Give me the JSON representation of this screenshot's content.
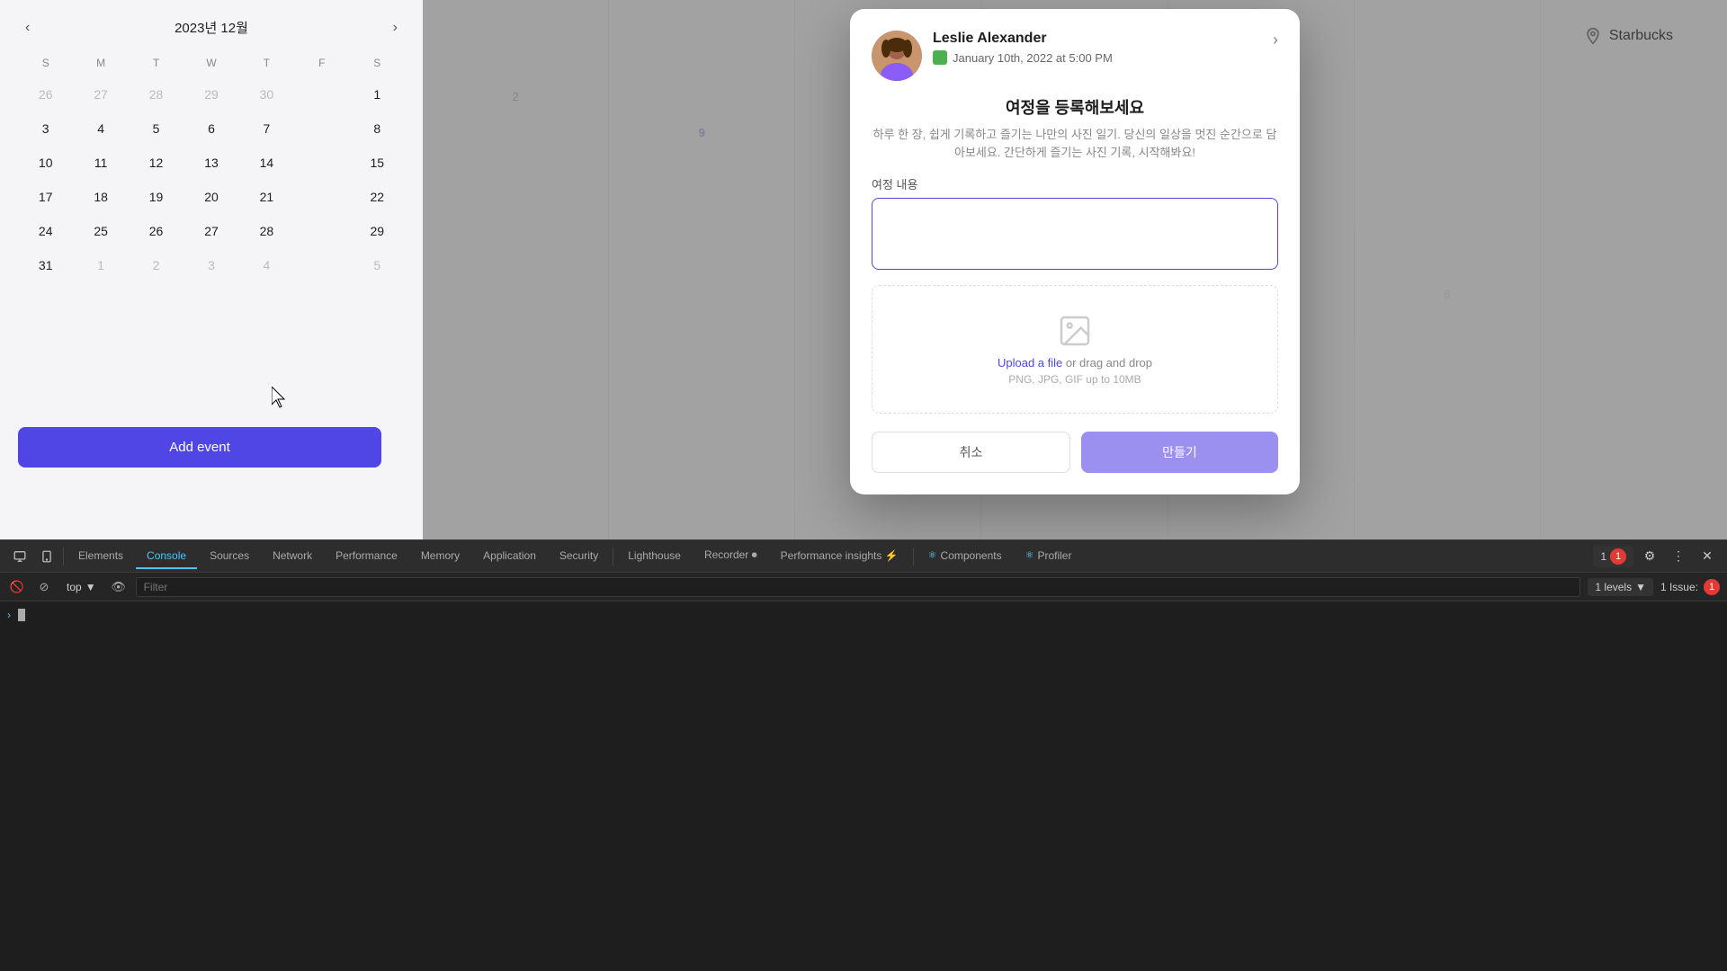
{
  "calendar": {
    "title": "2023년 12월",
    "weekdays": [
      "S",
      "M",
      "T",
      "W",
      "T",
      "F",
      "S"
    ],
    "weeks": [
      [
        {
          "day": "26",
          "type": "other-month"
        },
        {
          "day": "27",
          "type": "other-month"
        },
        {
          "day": "28",
          "type": "other-month"
        },
        {
          "day": "29",
          "type": "other-month"
        },
        {
          "day": "30",
          "type": "other-month"
        },
        {
          "day": "",
          "type": "empty"
        },
        {
          "day": "1",
          "type": "normal"
        }
      ],
      [
        {
          "day": "3",
          "type": "normal"
        },
        {
          "day": "4",
          "type": "normal"
        },
        {
          "day": "5",
          "type": "normal"
        },
        {
          "day": "6",
          "type": "normal"
        },
        {
          "day": "7",
          "type": "normal"
        },
        {
          "day": "",
          "type": "empty"
        },
        {
          "day": "8",
          "type": "normal"
        }
      ],
      [
        {
          "day": "10",
          "type": "normal"
        },
        {
          "day": "11",
          "type": "normal"
        },
        {
          "day": "12",
          "type": "normal"
        },
        {
          "day": "13",
          "type": "normal"
        },
        {
          "day": "14",
          "type": "normal"
        },
        {
          "day": "",
          "type": "empty"
        },
        {
          "day": "15",
          "type": "normal"
        }
      ],
      [
        {
          "day": "17",
          "type": "normal"
        },
        {
          "day": "18",
          "type": "normal"
        },
        {
          "day": "19",
          "type": "normal"
        },
        {
          "day": "20",
          "type": "normal"
        },
        {
          "day": "21",
          "type": "normal"
        },
        {
          "day": "",
          "type": "empty"
        },
        {
          "day": "22",
          "type": "normal"
        }
      ],
      [
        {
          "day": "24",
          "type": "normal"
        },
        {
          "day": "25",
          "type": "normal"
        },
        {
          "day": "26",
          "type": "normal"
        },
        {
          "day": "27",
          "type": "normal"
        },
        {
          "day": "28",
          "type": "normal"
        },
        {
          "day": "",
          "type": "empty"
        },
        {
          "day": "29",
          "type": "normal"
        }
      ],
      [
        {
          "day": "31",
          "type": "normal"
        },
        {
          "day": "1",
          "type": "other-month"
        },
        {
          "day": "2",
          "type": "other-month"
        },
        {
          "day": "3",
          "type": "other-month"
        },
        {
          "day": "4",
          "type": "other-month"
        },
        {
          "day": "",
          "type": "empty"
        },
        {
          "day": "5",
          "type": "other-month"
        }
      ]
    ],
    "add_event_label": "Add event"
  },
  "modal": {
    "profile_name": "Leslie Alexander",
    "event_date": "January 10th, 2022 at 5:00 PM",
    "location": "Starbucks",
    "title": "여정을 등록해보세요",
    "description": "하루 한 장, 쉽게 기록하고 즐기는 나만의 사진 일기. 당신의 일상을 멋진 순간으로 담아보세요. 간단하게 즐기는 사진 기록, 시작해봐요!",
    "content_label": "여정 내용",
    "upload_text_link": "Upload a file",
    "upload_text_rest": " or drag and drop",
    "upload_hint": "PNG, JPG, GIF up to 10MB",
    "cancel_label": "취소",
    "create_label": "만들기"
  },
  "devtools": {
    "tabs": [
      {
        "label": "Elements",
        "active": false
      },
      {
        "label": "Console",
        "active": true
      },
      {
        "label": "Sources",
        "active": false
      },
      {
        "label": "Network",
        "active": false
      },
      {
        "label": "Performance",
        "active": false
      },
      {
        "label": "Memory",
        "active": false
      },
      {
        "label": "Application",
        "active": false
      },
      {
        "label": "Security",
        "active": false
      },
      {
        "label": "Lighthouse",
        "active": false
      },
      {
        "label": "Recorder ⏺",
        "active": false
      },
      {
        "label": "Performance insights ⚡",
        "active": false
      },
      {
        "label": "Components",
        "active": false
      },
      {
        "label": "Profiler",
        "active": false
      }
    ],
    "console_toolbar": {
      "context": "top",
      "filter_placeholder": "Filter",
      "levels_label": "1 levels",
      "issue_count": "1 Issue:",
      "issue_number": "1"
    }
  }
}
